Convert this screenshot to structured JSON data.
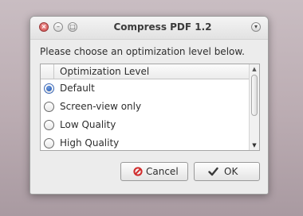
{
  "window": {
    "title": "Compress PDF 1.2",
    "controls": {
      "close_glyph": "×",
      "minimize_glyph": "–",
      "maximize_glyph": "□",
      "menu_glyph": "▾"
    }
  },
  "dialog": {
    "prompt": "Please choose an optimization level below.",
    "list": {
      "column_header": "Optimization Level",
      "options": [
        {
          "label": "Default",
          "selected": true
        },
        {
          "label": "Screen-view only",
          "selected": false
        },
        {
          "label": "Low Quality",
          "selected": false
        },
        {
          "label": "High Quality",
          "selected": false
        }
      ],
      "scroll_up_glyph": "▲",
      "scroll_down_glyph": "▼"
    },
    "buttons": {
      "cancel_label": "Cancel",
      "ok_label": "OK"
    }
  },
  "colors": {
    "cancel_icon": "#d12b2b",
    "radio_selected": "#2b5fb8",
    "close_button": "#d96060"
  }
}
